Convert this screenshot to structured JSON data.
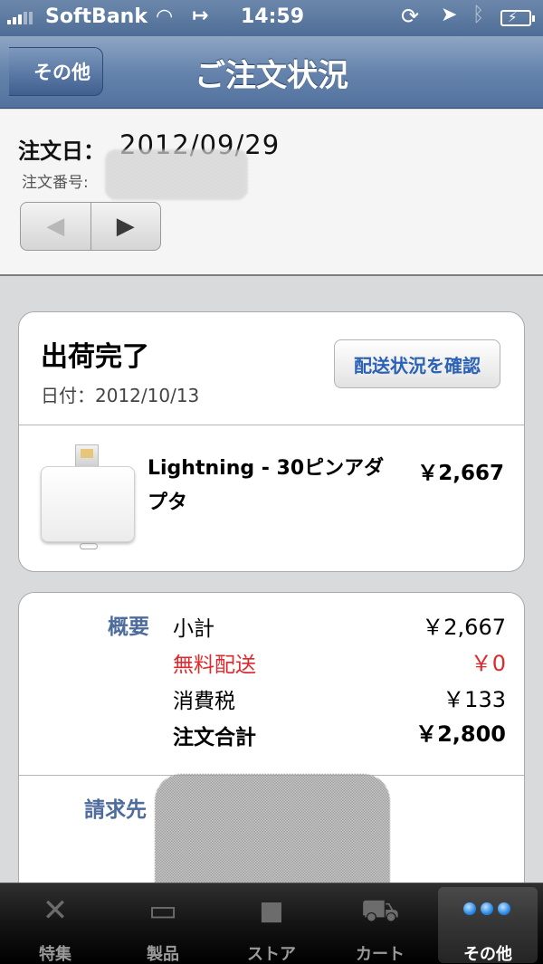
{
  "status_bar": {
    "carrier": "SoftBank",
    "time": "14:59",
    "wifi_icon": "wifi-icon",
    "lock_icon": "rotation-lock-icon",
    "location_icon": "location-arrow-icon",
    "bluetooth_icon": "bluetooth-icon",
    "battery_icon": "battery-charging-icon"
  },
  "navbar": {
    "back_label": "その他",
    "title": "ご注文状況"
  },
  "order": {
    "date_label": "注文日：",
    "date": "2012/09/29",
    "number_label": "注文番号:",
    "prev_glyph": "◀",
    "next_glyph": "▶"
  },
  "shipment": {
    "status": "出荷完了",
    "date_text": "日付：2012/10/13",
    "track_button": "配送状況を確認",
    "product_name": "Lightning - 30ピンアダプタ",
    "product_price": "￥2,667"
  },
  "summary": {
    "label": "概要",
    "rows": [
      {
        "label": "小計",
        "value": "￥2,667"
      },
      {
        "label": "無料配送",
        "value": "￥0"
      },
      {
        "label": "消費税",
        "value": "￥133"
      },
      {
        "label": "注文合計",
        "value": "￥2,800"
      }
    ],
    "billing_label": "請求先"
  },
  "tabbar": {
    "tabs": [
      {
        "label": "特集",
        "icon": "featured-icon"
      },
      {
        "label": "製品",
        "icon": "products-icon"
      },
      {
        "label": "ストア",
        "icon": "store-bag-icon"
      },
      {
        "label": "カート",
        "icon": "cart-icon"
      },
      {
        "label": "その他",
        "icon": "more-dots-icon"
      }
    ],
    "active_index": 4
  },
  "colors": {
    "nav_blue": "#5a7aa3",
    "accent_blue": "#2b62b3",
    "section_label": "#4d6b9c",
    "free_shipping_red": "#e1282c"
  }
}
